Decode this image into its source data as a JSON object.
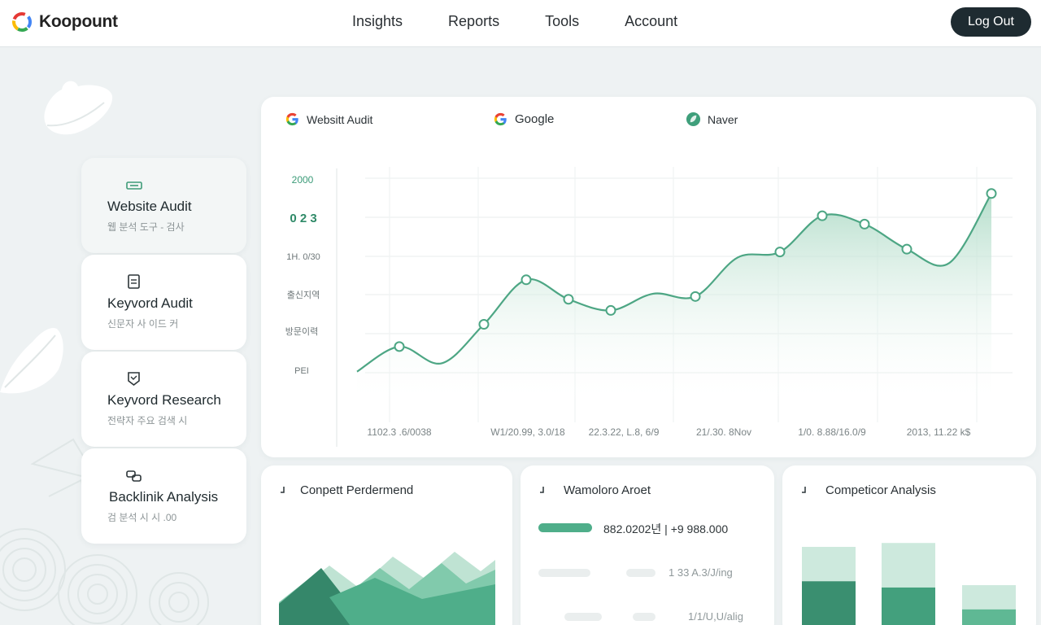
{
  "brand": {
    "name": "Koopount",
    "logo_icon": "brand-logo-icon"
  },
  "nav": {
    "items": [
      "Insights",
      "Reports",
      "Tools",
      "Account"
    ],
    "logout_label": "Log Out"
  },
  "sidebar": {
    "items": [
      {
        "icon": "audit-icon",
        "title": "Website Audit",
        "subtitle": "웹 분석 도구 - 검사"
      },
      {
        "icon": "document-icon",
        "title": "Keyvord Audit",
        "subtitle": "신문자 사 이드 커"
      },
      {
        "icon": "badge-icon",
        "title": "Keyvord Research",
        "subtitle": "전략자 주요 검색 시"
      },
      {
        "icon": "link-icon",
        "title": "Backlinik Analysis",
        "subtitle": "검 분석 시 시 .00"
      }
    ]
  },
  "chart": {
    "legend": [
      {
        "label": "Websitt Audit",
        "icon": "google-icon"
      },
      {
        "label": "Google",
        "icon": "google-icon"
      },
      {
        "label": "Naver",
        "icon": "naver-leaf-icon"
      }
    ],
    "y_labels": [
      "2000",
      "0 2 3",
      "1H. 0/30",
      "출신지역",
      "방문이력",
      "PEI"
    ],
    "x_labels": [
      "1102.3 .6/0038",
      "W1/20.99, 3.0/18",
      "22.3.22, L.8, 6/9",
      "21/.30. 8Nov",
      "1/0. 8.88/16.0/9",
      "2013, 11.22 k$"
    ]
  },
  "chart_data": {
    "type": "area",
    "title": "",
    "xlabel": "",
    "ylabel": "",
    "x": [
      0,
      1,
      2,
      3,
      4,
      5,
      6,
      7,
      8,
      9,
      10,
      11,
      12,
      13,
      14,
      15
    ],
    "series": [
      {
        "values": [
          7,
          16,
          10,
          24,
          40,
          33,
          29,
          35,
          34,
          48,
          50,
          63,
          60,
          51,
          46,
          71
        ]
      }
    ],
    "markers": [
      1,
      3,
      4,
      5,
      6,
      8,
      10,
      11,
      12,
      13,
      15
    ],
    "ylim": [
      -20,
      80
    ],
    "grid": true,
    "colors": {
      "line": "#4da684",
      "fill": "#bfe3d3"
    }
  },
  "bottom": {
    "concept": {
      "title": "Conpett Perdermend",
      "icon": "corner-icon"
    },
    "warehouse": {
      "title": "Wamoloro Aroet",
      "icon": "corner-icon",
      "rows": [
        {
          "label": "882.0202년 | +9 988.000",
          "fraction": 1.0,
          "color": "#4fae8a"
        },
        {
          "label": "1 33 A.3/J/ing",
          "fraction": 0.0,
          "color": "#eaeeee"
        },
        {
          "label": "1/1/U,U/alig",
          "fraction": 0.0,
          "color": "#eaeeee"
        }
      ]
    },
    "competitor": {
      "title": "Competicor Analysis",
      "icon": "corner-icon",
      "bars": [
        {
          "total": 100,
          "lower": 56
        },
        {
          "total": 105,
          "lower": 48
        },
        {
          "total": 51,
          "lower": 20
        }
      ]
    }
  },
  "colors": {
    "accent": "#4da684",
    "accent_dark": "#2f8a68",
    "accent_light": "#cde9dd",
    "dark_button": "#1e2b31"
  }
}
